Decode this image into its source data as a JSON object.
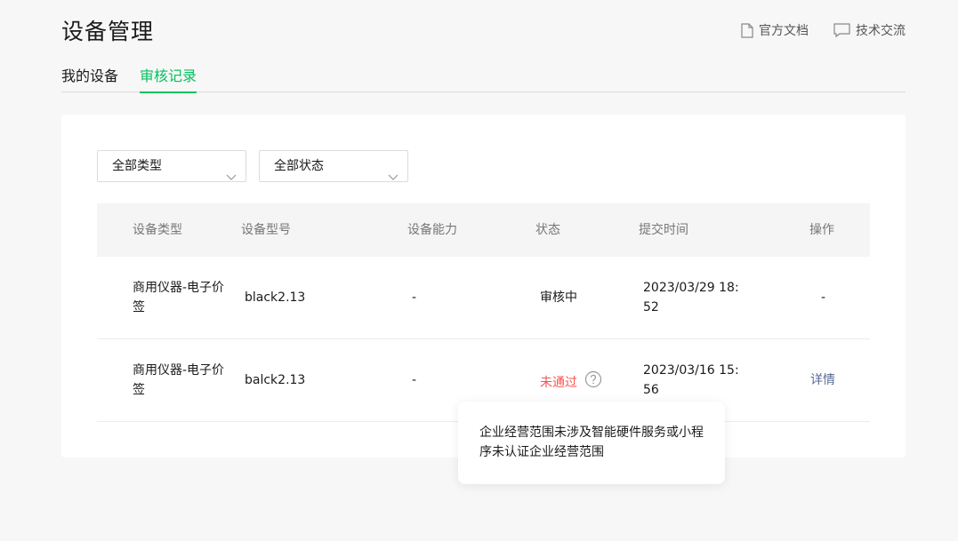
{
  "header": {
    "title": "设备管理",
    "links": [
      {
        "label": "官方文档",
        "icon": "document-icon"
      },
      {
        "label": "技术交流",
        "icon": "chat-icon"
      }
    ]
  },
  "tabs": [
    {
      "label": "我的设备",
      "active": false
    },
    {
      "label": "审核记录",
      "active": true
    }
  ],
  "filters": {
    "type": "全部类型",
    "status": "全部状态"
  },
  "table": {
    "columns": [
      "设备类型",
      "设备型号",
      "设备能力",
      "状态",
      "提交时间",
      "操作"
    ],
    "rows": [
      {
        "type_line1": "商用仪器-电子价",
        "type_line2": "签",
        "model": "black2.13",
        "ability": "-",
        "status": "审核中",
        "time_line1": "2023/03/29 18:",
        "time_line2": "52",
        "action": "-"
      },
      {
        "type_line1": "商用仪器-电子价",
        "type_line2": "签",
        "model": "balck2.13",
        "ability": "-",
        "status": "未通过",
        "time_line1": "2023/03/16 15:",
        "time_line2": "56",
        "action": "详情"
      }
    ]
  },
  "tooltip": {
    "line1": "企业经营范围未涉及智能硬件服务或小程",
    "line2": "序未认证企业经营范围"
  },
  "colors": {
    "accent": "#07c160",
    "error": "#fa5151",
    "link": "#576b95"
  }
}
